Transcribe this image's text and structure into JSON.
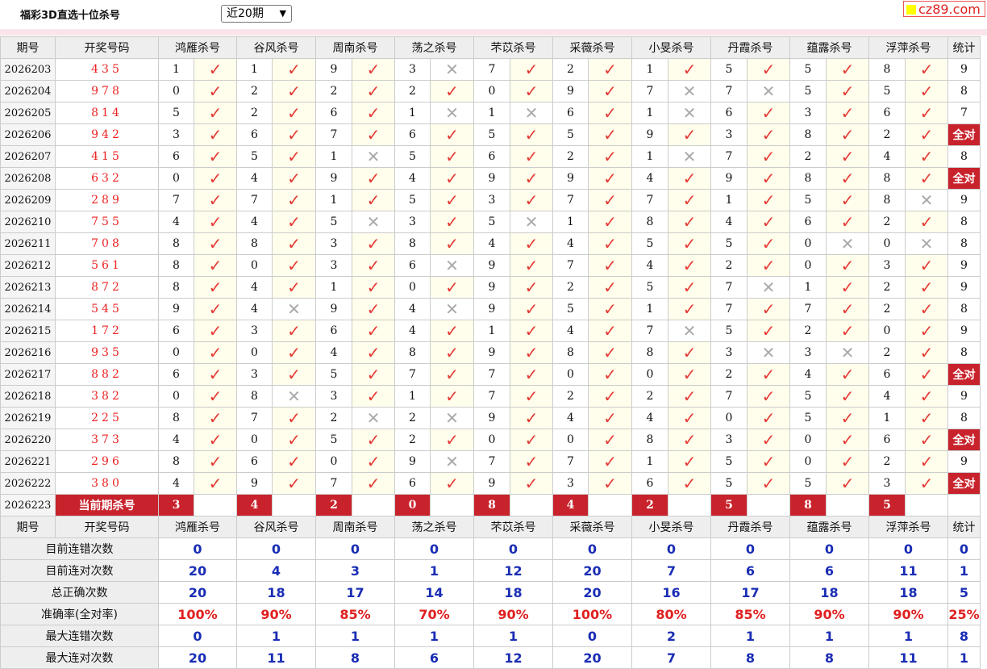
{
  "page": {
    "title": "福彩3D直选十位杀号",
    "period_selected": "近20期",
    "logo_text": "cz89.com"
  },
  "headers": {
    "issue": "期号",
    "draw": "开奖号码",
    "methods": [
      "鸿雁杀号",
      "谷风杀号",
      "周南杀号",
      "荡之杀号",
      "芣苡杀号",
      "采薇杀号",
      "小旻杀号",
      "丹霞杀号",
      "蕴露杀号",
      "浮萍杀号"
    ],
    "stat": "统计"
  },
  "symbols": {
    "ok": "✓",
    "bad": "✕"
  },
  "colors": {
    "accent_red": "#c8232c",
    "check_red": "#e53935",
    "stat_blue": "#1a2db4"
  },
  "rows": [
    {
      "issue": "2026203",
      "draw": "435",
      "kills": [
        1,
        1,
        9,
        3,
        7,
        2,
        1,
        5,
        5,
        8
      ],
      "hits": [
        1,
        1,
        1,
        0,
        1,
        1,
        1,
        1,
        1,
        1
      ],
      "total": "9"
    },
    {
      "issue": "2026204",
      "draw": "978",
      "kills": [
        0,
        2,
        2,
        2,
        0,
        9,
        7,
        7,
        5,
        5
      ],
      "hits": [
        1,
        1,
        1,
        1,
        1,
        1,
        0,
        0,
        1,
        1
      ],
      "total": "8"
    },
    {
      "issue": "2026205",
      "draw": "814",
      "kills": [
        5,
        2,
        6,
        1,
        1,
        6,
        1,
        6,
        3,
        6
      ],
      "hits": [
        1,
        1,
        1,
        0,
        0,
        1,
        0,
        1,
        1,
        1
      ],
      "total": "7"
    },
    {
      "issue": "2026206",
      "draw": "942",
      "kills": [
        3,
        6,
        7,
        6,
        5,
        5,
        9,
        3,
        8,
        2
      ],
      "hits": [
        1,
        1,
        1,
        1,
        1,
        1,
        1,
        1,
        1,
        1
      ],
      "total": "全对"
    },
    {
      "issue": "2026207",
      "draw": "415",
      "kills": [
        6,
        5,
        1,
        5,
        6,
        2,
        1,
        7,
        2,
        4
      ],
      "hits": [
        1,
        1,
        0,
        1,
        1,
        1,
        0,
        1,
        1,
        1
      ],
      "total": "8"
    },
    {
      "issue": "2026208",
      "draw": "632",
      "kills": [
        0,
        4,
        9,
        4,
        9,
        9,
        4,
        9,
        8,
        8
      ],
      "hits": [
        1,
        1,
        1,
        1,
        1,
        1,
        1,
        1,
        1,
        1
      ],
      "total": "全对"
    },
    {
      "issue": "2026209",
      "draw": "289",
      "kills": [
        7,
        7,
        1,
        5,
        3,
        7,
        7,
        1,
        5,
        8
      ],
      "hits": [
        1,
        1,
        1,
        1,
        1,
        1,
        1,
        1,
        1,
        0
      ],
      "total": "9"
    },
    {
      "issue": "2026210",
      "draw": "755",
      "kills": [
        4,
        4,
        5,
        3,
        5,
        1,
        8,
        4,
        6,
        2
      ],
      "hits": [
        1,
        1,
        0,
        1,
        0,
        1,
        1,
        1,
        1,
        1
      ],
      "total": "8"
    },
    {
      "issue": "2026211",
      "draw": "708",
      "kills": [
        8,
        8,
        3,
        8,
        4,
        4,
        5,
        5,
        0,
        0
      ],
      "hits": [
        1,
        1,
        1,
        1,
        1,
        1,
        1,
        1,
        0,
        0
      ],
      "total": "8"
    },
    {
      "issue": "2026212",
      "draw": "561",
      "kills": [
        8,
        0,
        3,
        6,
        9,
        7,
        4,
        2,
        0,
        3
      ],
      "hits": [
        1,
        1,
        1,
        0,
        1,
        1,
        1,
        1,
        1,
        1
      ],
      "total": "9"
    },
    {
      "issue": "2026213",
      "draw": "872",
      "kills": [
        8,
        4,
        1,
        0,
        9,
        2,
        5,
        7,
        1,
        2
      ],
      "hits": [
        1,
        1,
        1,
        1,
        1,
        1,
        1,
        0,
        1,
        1
      ],
      "total": "9"
    },
    {
      "issue": "2026214",
      "draw": "545",
      "kills": [
        9,
        4,
        9,
        4,
        9,
        5,
        1,
        7,
        7,
        2
      ],
      "hits": [
        1,
        0,
        1,
        0,
        1,
        1,
        1,
        1,
        1,
        1
      ],
      "total": "8"
    },
    {
      "issue": "2026215",
      "draw": "172",
      "kills": [
        6,
        3,
        6,
        4,
        1,
        4,
        7,
        5,
        2,
        0
      ],
      "hits": [
        1,
        1,
        1,
        1,
        1,
        1,
        0,
        1,
        1,
        1
      ],
      "total": "9"
    },
    {
      "issue": "2026216",
      "draw": "935",
      "kills": [
        0,
        0,
        4,
        8,
        9,
        8,
        8,
        3,
        3,
        2
      ],
      "hits": [
        1,
        1,
        1,
        1,
        1,
        1,
        1,
        0,
        0,
        1
      ],
      "total": "8"
    },
    {
      "issue": "2026217",
      "draw": "882",
      "kills": [
        6,
        3,
        5,
        7,
        7,
        0,
        0,
        2,
        4,
        6
      ],
      "hits": [
        1,
        1,
        1,
        1,
        1,
        1,
        1,
        1,
        1,
        1
      ],
      "total": "全对"
    },
    {
      "issue": "2026218",
      "draw": "382",
      "kills": [
        0,
        8,
        3,
        1,
        7,
        2,
        2,
        7,
        5,
        4
      ],
      "hits": [
        1,
        0,
        1,
        1,
        1,
        1,
        1,
        1,
        1,
        1
      ],
      "total": "9"
    },
    {
      "issue": "2026219",
      "draw": "225",
      "kills": [
        8,
        7,
        2,
        2,
        9,
        4,
        4,
        0,
        5,
        1
      ],
      "hits": [
        1,
        1,
        0,
        0,
        1,
        1,
        1,
        1,
        1,
        1
      ],
      "total": "8"
    },
    {
      "issue": "2026220",
      "draw": "373",
      "kills": [
        4,
        0,
        5,
        2,
        0,
        0,
        8,
        3,
        0,
        6
      ],
      "hits": [
        1,
        1,
        1,
        1,
        1,
        1,
        1,
        1,
        1,
        1
      ],
      "total": "全对"
    },
    {
      "issue": "2026221",
      "draw": "296",
      "kills": [
        8,
        6,
        0,
        9,
        7,
        7,
        1,
        5,
        0,
        2
      ],
      "hits": [
        1,
        1,
        1,
        0,
        1,
        1,
        1,
        1,
        1,
        1
      ],
      "total": "9"
    },
    {
      "issue": "2026222",
      "draw": "380",
      "kills": [
        4,
        9,
        7,
        6,
        9,
        3,
        6,
        5,
        5,
        3
      ],
      "hits": [
        1,
        1,
        1,
        1,
        1,
        1,
        1,
        1,
        1,
        1
      ],
      "total": "全对"
    }
  ],
  "current": {
    "issue": "2026223",
    "label": "当前期杀号",
    "kills": [
      "3",
      "4",
      "2",
      "0",
      "8",
      "4",
      "2",
      "5",
      "8",
      "5"
    ]
  },
  "stats": [
    {
      "label": "目前连错次数",
      "values": [
        "0",
        "0",
        "0",
        "0",
        "0",
        "0",
        "0",
        "0",
        "0",
        "0"
      ],
      "total": "0",
      "color": "blue"
    },
    {
      "label": "目前连对次数",
      "values": [
        "20",
        "4",
        "3",
        "1",
        "12",
        "20",
        "7",
        "6",
        "6",
        "11"
      ],
      "total": "1",
      "color": "blue"
    },
    {
      "label": "总正确次数",
      "values": [
        "20",
        "18",
        "17",
        "14",
        "18",
        "20",
        "16",
        "17",
        "18",
        "18"
      ],
      "total": "5",
      "color": "blue"
    },
    {
      "label": "准确率(全对率)",
      "values": [
        "100%",
        "90%",
        "85%",
        "70%",
        "90%",
        "100%",
        "80%",
        "85%",
        "90%",
        "90%"
      ],
      "total": "25%",
      "color": "red"
    },
    {
      "label": "最大连错次数",
      "values": [
        "0",
        "1",
        "1",
        "1",
        "1",
        "0",
        "2",
        "1",
        "1",
        "1"
      ],
      "total": "8",
      "color": "blue"
    },
    {
      "label": "最大连对次数",
      "values": [
        "20",
        "11",
        "8",
        "6",
        "12",
        "20",
        "7",
        "8",
        "8",
        "11"
      ],
      "total": "1",
      "color": "blue"
    }
  ]
}
